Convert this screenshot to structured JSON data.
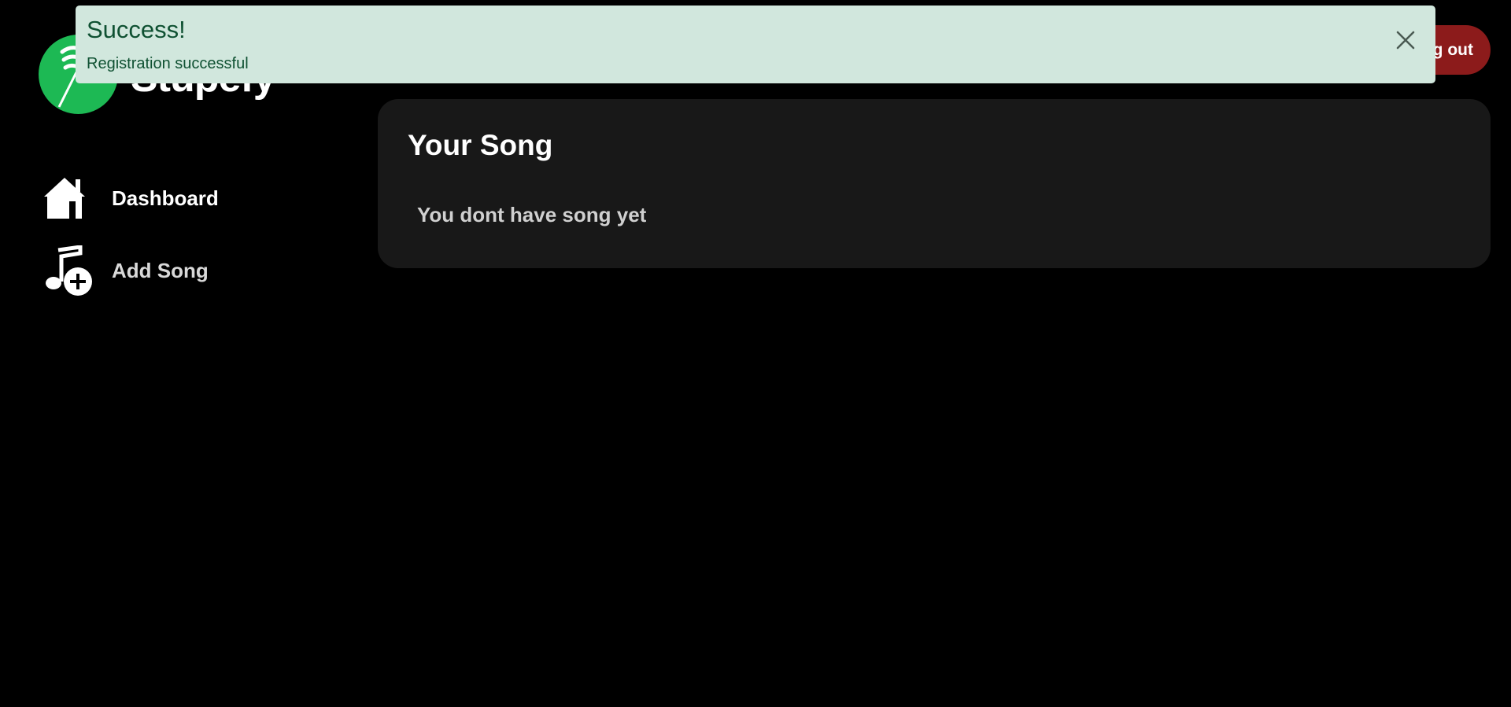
{
  "app": {
    "logo_text": "Stupefy",
    "brand_color": "#1db954"
  },
  "sidebar": {
    "items": [
      {
        "label": "Dashboard",
        "icon": "home-icon",
        "active": true
      },
      {
        "label": "Add Song",
        "icon": "music-note-add-icon",
        "active": false
      }
    ]
  },
  "header": {
    "logout_label": "Log out",
    "logout_color": "#8c1b1b"
  },
  "main": {
    "title": "Your Song",
    "empty_message": "You dont have song yet"
  },
  "toast": {
    "title": "Success!",
    "message": "Registration successful",
    "background": "#d1e7dd",
    "text_color": "#0f5132"
  }
}
